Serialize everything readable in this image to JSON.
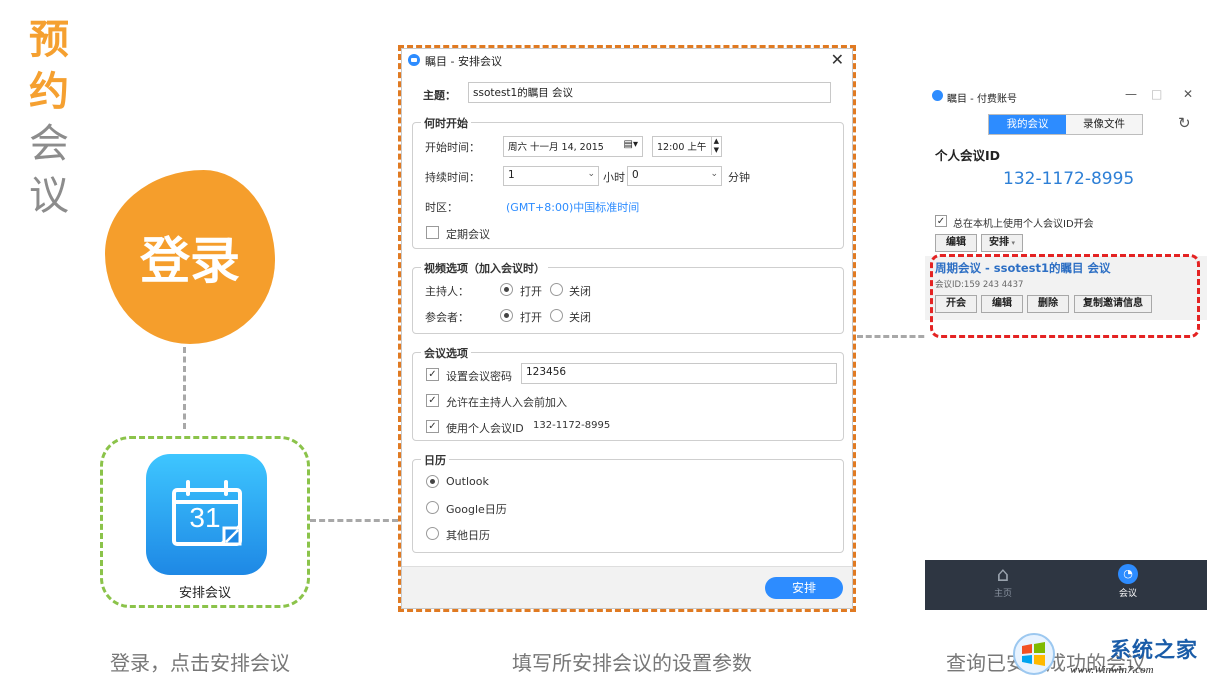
{
  "side_title": {
    "c1": "预",
    "c2": "约",
    "c3": "会",
    "c4": "议"
  },
  "login_blob": "登录",
  "app_icon": {
    "day": "31",
    "label": "安排会议"
  },
  "captions": {
    "left": "登录，点击安排会议",
    "middle": "填写所安排会议的设置参数",
    "right": "查询已安排成功的会议"
  },
  "dialog": {
    "title": "瞩目 - 安排会议",
    "close": "✕",
    "topic_label": "主题：",
    "topic_value": "ssotest1的瞩目 会议",
    "when": {
      "group_title": "何时开始",
      "start_label": "开始时间：",
      "start_date": "周六  十一月 14, 2015",
      "start_time": "12:00 上午",
      "duration_label": "持续时间：",
      "hours_value": "1",
      "hours_unit": "小时",
      "minutes_value": "0",
      "minutes_unit": "分钟",
      "tz_label": "时区：",
      "tz_value": "(GMT+8:00)中国标准时间",
      "recurring_label": "定期会议"
    },
    "video": {
      "group_title": "视频选项（加入会议时）",
      "host_label": "主持人：",
      "participant_label": "参会者：",
      "on": "打开",
      "off": "关闭"
    },
    "options": {
      "group_title": "会议选项",
      "password_label": "设置会议密码",
      "password_value": "123456",
      "join_before_host": "允许在主持人入会前加入",
      "use_pmi": "使用个人会议ID",
      "pmi_value": "132-1172-8995"
    },
    "calendar": {
      "group_title": "日历",
      "outlook": "Outlook",
      "google": "Google日历",
      "other": "其他日历"
    },
    "schedule_button": "安排"
  },
  "right_panel": {
    "title": "瞩目 - 付费账号",
    "tab_my_meetings": "我的会议",
    "tab_recordings": "录像文件",
    "pmi_label": "个人会议ID",
    "pmi_number": "132-1172-8995",
    "pmi_checkbox": "总在本机上使用个人会议ID开会",
    "edit": "编辑",
    "schedule": "安排",
    "meeting_title": "周期会议 - ssotest1的瞩目 会议",
    "meeting_id": "会议ID:159 243 4437",
    "start": "开会",
    "delete": "删除",
    "copy_invite": "复制邀请信息",
    "nav_home": "主页",
    "nav_meeting": "会议"
  },
  "watermark": {
    "text": "系统之家",
    "url": "www.Winwin7.com"
  },
  "colors": {
    "accent_orange": "#f59e2c",
    "zoom_blue": "#2d8cff",
    "dash_green": "#8bc34a",
    "dash_red": "#e42323"
  }
}
